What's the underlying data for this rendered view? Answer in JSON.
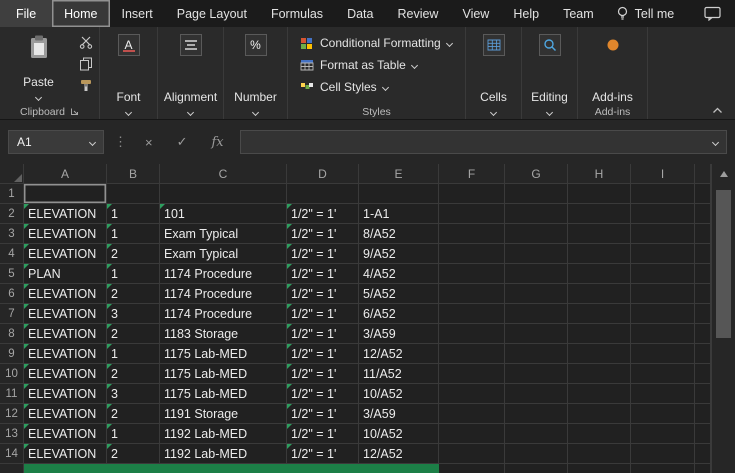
{
  "tabs": [
    {
      "label": "File",
      "active": false
    },
    {
      "label": "Home",
      "active": true
    },
    {
      "label": "Insert",
      "active": false
    },
    {
      "label": "Page Layout",
      "active": false
    },
    {
      "label": "Formulas",
      "active": false
    },
    {
      "label": "Data",
      "active": false
    },
    {
      "label": "Review",
      "active": false
    },
    {
      "label": "View",
      "active": false
    },
    {
      "label": "Help",
      "active": false
    },
    {
      "label": "Team",
      "active": false
    }
  ],
  "tell_me": "Tell me",
  "ribbon": {
    "paste_label": "Paste",
    "clipboard_group": "Clipboard",
    "font_label": "Font",
    "alignment_label": "Alignment",
    "number_label": "Number",
    "styles": {
      "conditional_formatting": "Conditional Formatting",
      "format_as_table": "Format as Table",
      "cell_styles": "Cell Styles",
      "group": "Styles"
    },
    "cells_label": "Cells",
    "editing_label": "Editing",
    "addins_label": "Add-ins",
    "addins_group": "Add-ins"
  },
  "formula_bar": {
    "name_box": "A1",
    "cancel": "×",
    "enter": "✓",
    "fx_label": "fx",
    "formula_value": ""
  },
  "sheet": {
    "active_cell": "A1",
    "column_headers": [
      "A",
      "B",
      "C",
      "D",
      "E",
      "F",
      "G",
      "H",
      "I"
    ],
    "rows": [
      {
        "n": "1",
        "cells": [
          "",
          "",
          "",
          "",
          ""
        ],
        "flags": []
      },
      {
        "n": "2",
        "cells": [
          "ELEVATION",
          "1",
          "101",
          "1/2\" = 1'",
          "1-A1"
        ],
        "flags": [
          0,
          1,
          2,
          3
        ]
      },
      {
        "n": "3",
        "cells": [
          "ELEVATION",
          "1",
          "Exam Typical",
          "1/2\" = 1'",
          "8/A52"
        ],
        "flags": [
          0,
          1,
          3
        ]
      },
      {
        "n": "4",
        "cells": [
          "ELEVATION",
          "2",
          "Exam Typical",
          "1/2\" = 1'",
          "9/A52"
        ],
        "flags": [
          0,
          1,
          3
        ]
      },
      {
        "n": "5",
        "cells": [
          "PLAN",
          "1",
          "1174 Procedure",
          "1/2\" = 1'",
          "4/A52"
        ],
        "flags": [
          0,
          1,
          3
        ]
      },
      {
        "n": "6",
        "cells": [
          "ELEVATION",
          "2",
          "1174 Procedure",
          "1/2\" = 1'",
          "5/A52"
        ],
        "flags": [
          0,
          1,
          3
        ]
      },
      {
        "n": "7",
        "cells": [
          "ELEVATION",
          "3",
          "1174 Procedure",
          "1/2\" = 1'",
          "6/A52"
        ],
        "flags": [
          0,
          1,
          3
        ]
      },
      {
        "n": "8",
        "cells": [
          "ELEVATION",
          "2",
          "1183 Storage",
          "1/2\" = 1'",
          "3/A59"
        ],
        "flags": [
          0,
          1,
          3
        ]
      },
      {
        "n": "9",
        "cells": [
          "ELEVATION",
          "1",
          "1175 Lab-MED",
          "1/2\" = 1'",
          "12/A52"
        ],
        "flags": [
          0,
          1,
          3
        ]
      },
      {
        "n": "10",
        "cells": [
          "ELEVATION",
          "2",
          "1175 Lab-MED",
          "1/2\" = 1'",
          "11/A52"
        ],
        "flags": [
          0,
          1,
          3
        ]
      },
      {
        "n": "11",
        "cells": [
          "ELEVATION",
          "3",
          "1175 Lab-MED",
          "1/2\" = 1'",
          "10/A52"
        ],
        "flags": [
          0,
          1,
          3
        ]
      },
      {
        "n": "12",
        "cells": [
          "ELEVATION",
          "2",
          "1191 Storage",
          "1/2\" = 1'",
          "3/A59"
        ],
        "flags": [
          0,
          1,
          3
        ]
      },
      {
        "n": "13",
        "cells": [
          "ELEVATION",
          "1",
          "1192 Lab-MED",
          "1/2\" = 1'",
          "10/A52"
        ],
        "flags": [
          0,
          1,
          3
        ]
      },
      {
        "n": "14",
        "cells": [
          "ELEVATION",
          "2",
          "1192 Lab-MED",
          "1/2\" = 1'",
          "12/A52"
        ],
        "flags": [
          0,
          1,
          3
        ]
      }
    ]
  },
  "colors": {
    "error_flag_green": "#2e9e5f",
    "hidden_row_green": "#1c7f47",
    "addin_orange": "#e0862c",
    "editing_blue": "#4ea6e0"
  }
}
